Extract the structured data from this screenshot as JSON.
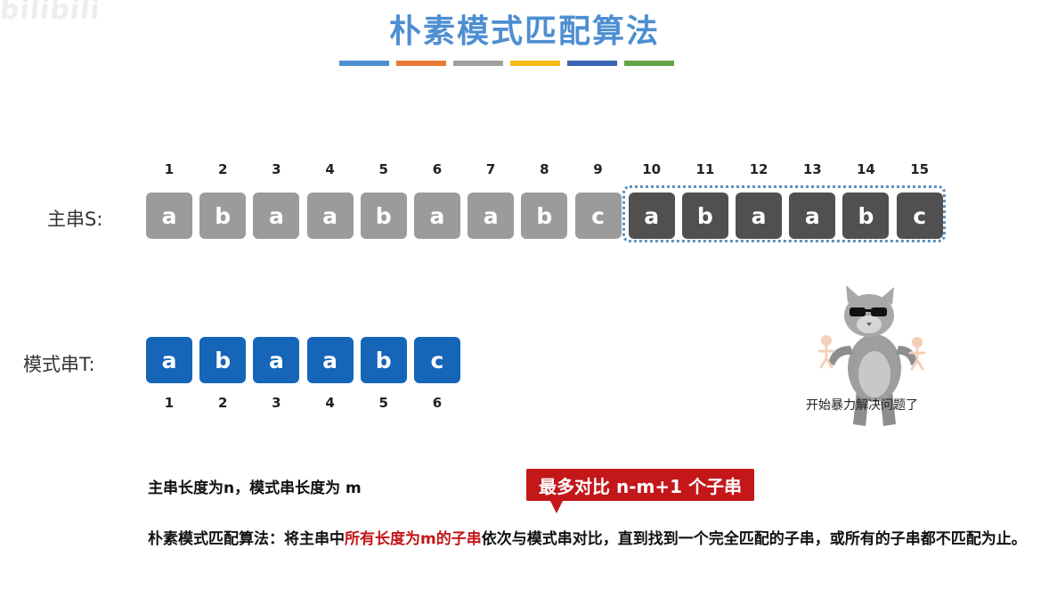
{
  "watermark": "bilibili",
  "title": "朴素模式匹配算法",
  "colors": {
    "title": "#4d8fd1",
    "bar": [
      "#4d8fd1",
      "#ea7a35",
      "#a0a0a0",
      "#f5bb16",
      "#3c64b4",
      "#62a544"
    ],
    "cell_light": "#9b9b9b",
    "cell_dark": "#505050",
    "cell_blue": "#1565b8",
    "highlight": "#c3171a"
  },
  "main_string": {
    "label": "主串S:",
    "indices": [
      "1",
      "2",
      "3",
      "4",
      "5",
      "6",
      "7",
      "8",
      "9",
      "10",
      "11",
      "12",
      "13",
      "14",
      "15"
    ],
    "chars": [
      "a",
      "b",
      "a",
      "a",
      "b",
      "a",
      "a",
      "b",
      "c",
      "a",
      "b",
      "a",
      "a",
      "b",
      "c"
    ],
    "highlighted_range": [
      10,
      15
    ]
  },
  "pattern_string": {
    "label": "模式串T:",
    "indices": [
      "1",
      "2",
      "3",
      "4",
      "5",
      "6"
    ],
    "chars": [
      "a",
      "b",
      "a",
      "a",
      "b",
      "c"
    ]
  },
  "cat_caption": "开始暴力解决问题了",
  "length_line": "主串长度为n，模式串长度为 m",
  "callout": "最多对比 n-m+1 个子串",
  "paragraph": {
    "part1": "朴素模式匹配算法：将主串中",
    "part2_red": "所有长度为m的子串",
    "part3": "依次与模式串对比，直到找到一个完全匹配的子串，或所有的子串都不匹配为止。"
  }
}
